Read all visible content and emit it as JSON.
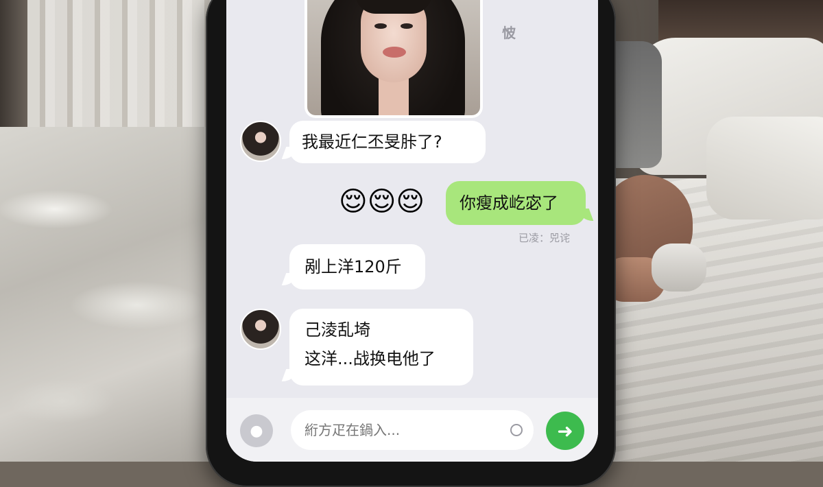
{
  "chat": {
    "watermark": "怶",
    "messages": [
      {
        "text": "我最近仁丕旻胩了?"
      },
      {
        "text": "你瘦成屹宓了"
      },
      {
        "text": "剐上洋120斤"
      },
      {
        "line1": "己淩乱埼",
        "line2": "这洋...战换电他了"
      }
    ],
    "emojis": "😌😌😌",
    "read_status": "已凌：兕诧"
  },
  "input": {
    "placeholder": "絎方疋在鍋入..."
  },
  "icons": {
    "mic": "mic-icon",
    "send": "send-icon",
    "emoji": "emoji-icon"
  },
  "colors": {
    "sent_bubble": "#a8e67c",
    "received_bubble": "#ffffff",
    "send_button": "#3dbb4e",
    "chat_background": "#e9e9ef"
  }
}
